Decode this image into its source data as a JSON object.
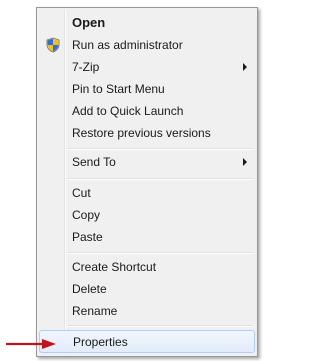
{
  "menu": {
    "items": [
      {
        "label": "Open"
      },
      {
        "label": "Run as administrator"
      },
      {
        "label": "7-Zip"
      },
      {
        "label": "Pin to Start Menu"
      },
      {
        "label": "Add to Quick Launch"
      },
      {
        "label": "Restore previous versions"
      },
      {
        "label": "Send To"
      },
      {
        "label": "Cut"
      },
      {
        "label": "Copy"
      },
      {
        "label": "Paste"
      },
      {
        "label": "Create Shortcut"
      },
      {
        "label": "Delete"
      },
      {
        "label": "Rename"
      },
      {
        "label": "Properties"
      }
    ],
    "highlighted_item": "Properties"
  },
  "icons": {
    "admin": "uac-shield-icon",
    "pointer": "red-arrow-icon",
    "submenu": "submenu-arrow-icon"
  },
  "colors": {
    "highlight_border": "#aecff7",
    "pointer_arrow": "#c0141c",
    "menu_background": "#f0f0f0"
  }
}
